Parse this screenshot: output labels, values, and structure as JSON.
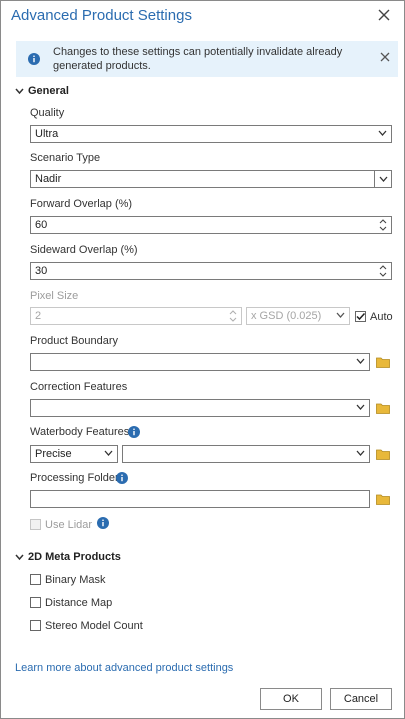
{
  "dialog": {
    "title": "Advanced Product Settings"
  },
  "banner": {
    "message": "Changes to these settings can potentially invalidate already generated products."
  },
  "general": {
    "heading": "General",
    "quality": {
      "label": "Quality",
      "value": "Ultra"
    },
    "scenario": {
      "label": "Scenario Type",
      "value": "Nadir"
    },
    "forward": {
      "label": "Forward Overlap (%)",
      "value": "60"
    },
    "sideward": {
      "label": "Sideward Overlap (%)",
      "value": "30"
    },
    "pixel": {
      "label": "Pixel Size",
      "value": "2",
      "unit": "x GSD (0.025)",
      "auto_label": "Auto",
      "auto_checked": true
    },
    "boundary": {
      "label": "Product Boundary",
      "value": ""
    },
    "correction": {
      "label": "Correction Features",
      "value": ""
    },
    "waterbody": {
      "label": "Waterbody Features",
      "mode": "Precise",
      "value": ""
    },
    "processing": {
      "label": "Processing Folder",
      "value": ""
    },
    "lidar": {
      "label": "Use Lidar",
      "checked": false
    }
  },
  "meta": {
    "heading": "2D Meta Products",
    "items": [
      {
        "label": "Binary Mask",
        "checked": false
      },
      {
        "label": "Distance Map",
        "checked": false
      },
      {
        "label": "Stereo Model Count",
        "checked": false
      }
    ]
  },
  "footer": {
    "link": "Learn more about advanced product settings",
    "ok": "OK",
    "cancel": "Cancel"
  },
  "colors": {
    "accent": "#2b6cb0",
    "banner_bg": "#e6f2fb",
    "folder": "#e8b83a"
  }
}
